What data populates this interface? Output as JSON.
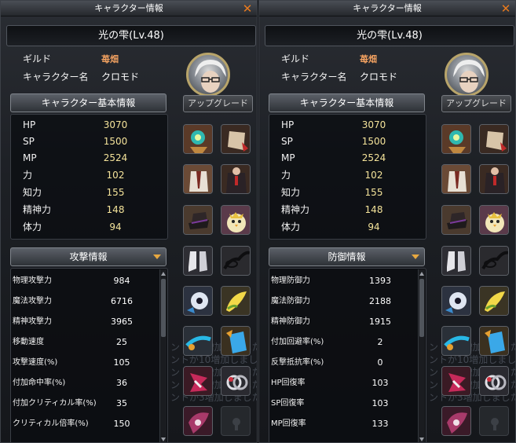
{
  "left": {
    "title": "キャラクター情報",
    "close_label": "✕",
    "character_name": "光の雫(Lv.48)",
    "guild_label": "ギルド",
    "guild_value": "苺畑",
    "char_name_label": "キャラクター名",
    "char_name_value": "クロモド",
    "upgrade_label": "アップグレード",
    "base_info_title": "キャラクター基本情報",
    "base_stats": [
      {
        "label": "HP",
        "value": "3070"
      },
      {
        "label": "SP",
        "value": "1500"
      },
      {
        "label": "MP",
        "value": "2524"
      },
      {
        "label": "力",
        "value": "102"
      },
      {
        "label": "知力",
        "value": "155"
      },
      {
        "label": "精神力",
        "value": "148"
      },
      {
        "label": "体力",
        "value": "94"
      }
    ],
    "detail_title": "攻撃情報",
    "detail_stats": [
      {
        "label": "物理攻撃力",
        "value": "984"
      },
      {
        "label": "魔法攻撃力",
        "value": "6716"
      },
      {
        "label": "精神攻撃力",
        "value": "3965"
      },
      {
        "label": "移動速度",
        "value": "25"
      },
      {
        "label": "攻撃速度(%)",
        "value": "105"
      },
      {
        "label": "付加命中率(%)",
        "value": "36"
      },
      {
        "label": "付加クリティカル率(%)",
        "value": "35"
      },
      {
        "label": "クリティカル倍率(%)",
        "value": "150"
      }
    ]
  },
  "right": {
    "title": "キャラクター情報",
    "close_label": "✕",
    "character_name": "光の雫(Lv.48)",
    "guild_label": "ギルド",
    "guild_value": "苺畑",
    "char_name_label": "キャラクター名",
    "char_name_value": "クロモド",
    "upgrade_label": "アップグレード",
    "base_info_title": "キャラクター基本情報",
    "base_stats": [
      {
        "label": "HP",
        "value": "3070"
      },
      {
        "label": "SP",
        "value": "1500"
      },
      {
        "label": "MP",
        "value": "2524"
      },
      {
        "label": "力",
        "value": "102"
      },
      {
        "label": "知力",
        "value": "155"
      },
      {
        "label": "精神力",
        "value": "148"
      },
      {
        "label": "体力",
        "value": "94"
      }
    ],
    "detail_title": "防御情報",
    "detail_stats": [
      {
        "label": "物理防御力",
        "value": "1393"
      },
      {
        "label": "魔法防御力",
        "value": "2188"
      },
      {
        "label": "精神防御力",
        "value": "1915"
      },
      {
        "label": "付加回避率(%)",
        "value": "2"
      },
      {
        "label": "反撃抵抗率(%)",
        "value": "0"
      },
      {
        "label": "HP回復率",
        "value": "103"
      },
      {
        "label": "SP回復率",
        "value": "103"
      },
      {
        "label": "MP回復率",
        "value": "133"
      }
    ]
  },
  "background_chat": [
    "ントが5増加しました。",
    "ントが10増加しました。",
    "ントが4増加しました。",
    "ントが6増加しました。",
    "ントが3増加しました。"
  ],
  "colors": {
    "accent_orange": "#e87a1e",
    "stat_value": "#f4e39a",
    "guild_value": "#f0a060"
  },
  "equipment_icons": [
    "amulet-icon",
    "cape-icon",
    "jacket-icon",
    "coat-icon",
    "hat-icon",
    "chick-pet-icon",
    "boots-icon",
    "glasses-icon",
    "silver-flower-icon",
    "yellow-wing-icon",
    "blue-staff-icon",
    "blue-book-icon",
    "red-wing-icon",
    "silver-ring-icon",
    "pink-wing-icon",
    "empty-slot-icon"
  ]
}
